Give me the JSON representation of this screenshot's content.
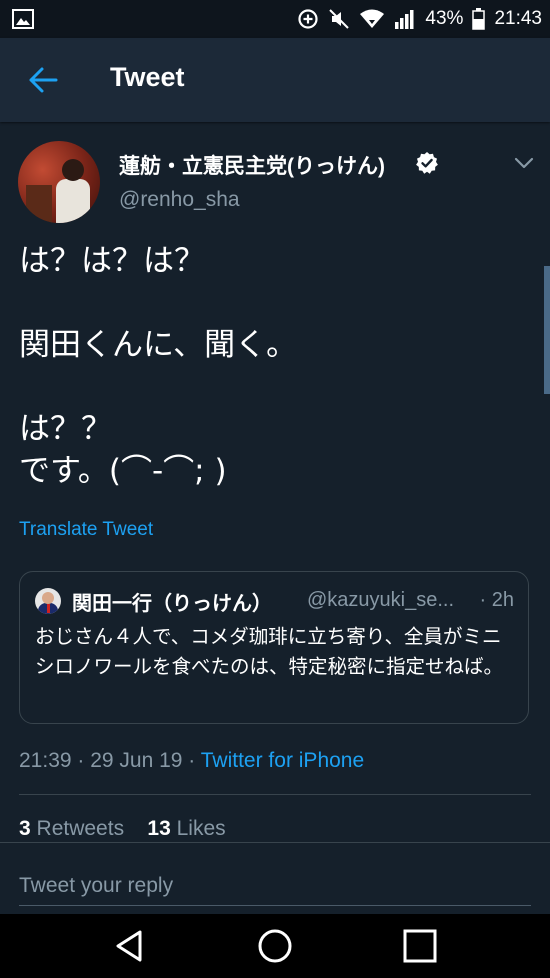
{
  "status_bar": {
    "battery": "43%",
    "time": "21:43",
    "icons": [
      "gallery-icon",
      "data-saver-icon",
      "mute-icon",
      "wifi-icon",
      "signal-icon",
      "battery-icon"
    ]
  },
  "header": {
    "title": "Tweet",
    "back_icon": "arrow-left-icon"
  },
  "tweet": {
    "author_name": "蓮舫・立憲民主党(りっけん)",
    "verified": true,
    "handle": "@renho_sha",
    "text": "は？は？は？\n\n関田くんに、聞く。\n\nは？？\nです。(⌒-⌒; )",
    "translate_label": "Translate Tweet",
    "timestamp": "21:39 · 29 Jun 19 · ",
    "source": "Twitter for iPhone",
    "retweets_count": "3",
    "retweets_label": "Retweets",
    "likes_count": "13",
    "likes_label": "Likes"
  },
  "quoted_tweet": {
    "name": "関田一行（りっけん）",
    "handle": "@kazuyuki_se...",
    "time": "· 2h",
    "text": "おじさん４人で、コメダ珈琲に立ち寄り、全員がミニシロノワールを食べたのは、特定秘密に指定せねば。"
  },
  "reply": {
    "placeholder": "Tweet your reply"
  },
  "colors": {
    "background": "#15202b",
    "header": "#1c2938",
    "accent": "#1da1f2",
    "secondary_text": "#8899a6",
    "border": "#38444d"
  }
}
